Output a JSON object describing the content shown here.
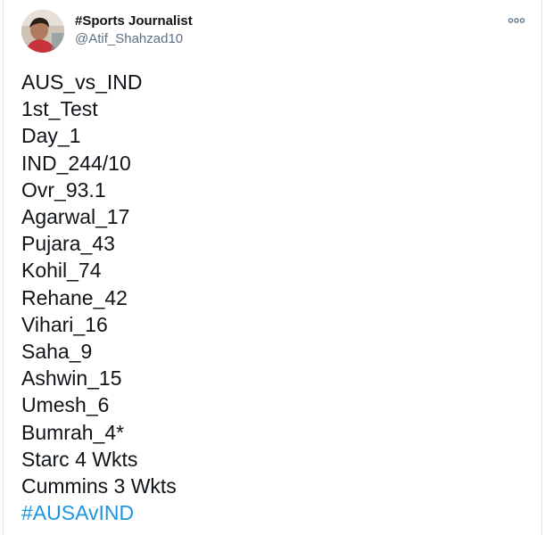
{
  "tweet": {
    "author": {
      "display_name": "#Sports Journalist",
      "handle": "@Atif_Shahzad10",
      "avatar_icon": "profile-photo"
    },
    "more_icon": "more-horizontal-icon",
    "lines": [
      "AUS_vs_IND",
      "1st_Test",
      "Day_1",
      "IND_244/10",
      "Ovr_93.1",
      "Agarwal_17",
      "Pujara_43",
      "Kohil_74",
      "Rehane_42",
      "Vihari_16",
      "Saha_9",
      "Ashwin_15",
      "Umesh_6",
      "Bumrah_4*",
      "Starc 4 Wkts",
      "Cummins 3 Wkts"
    ],
    "hashtag": "#AUSAvIND",
    "colors": {
      "text": "#0f1419",
      "secondary": "#5b7083",
      "link": "#1b95e0",
      "border": "#e1e8ed"
    }
  }
}
